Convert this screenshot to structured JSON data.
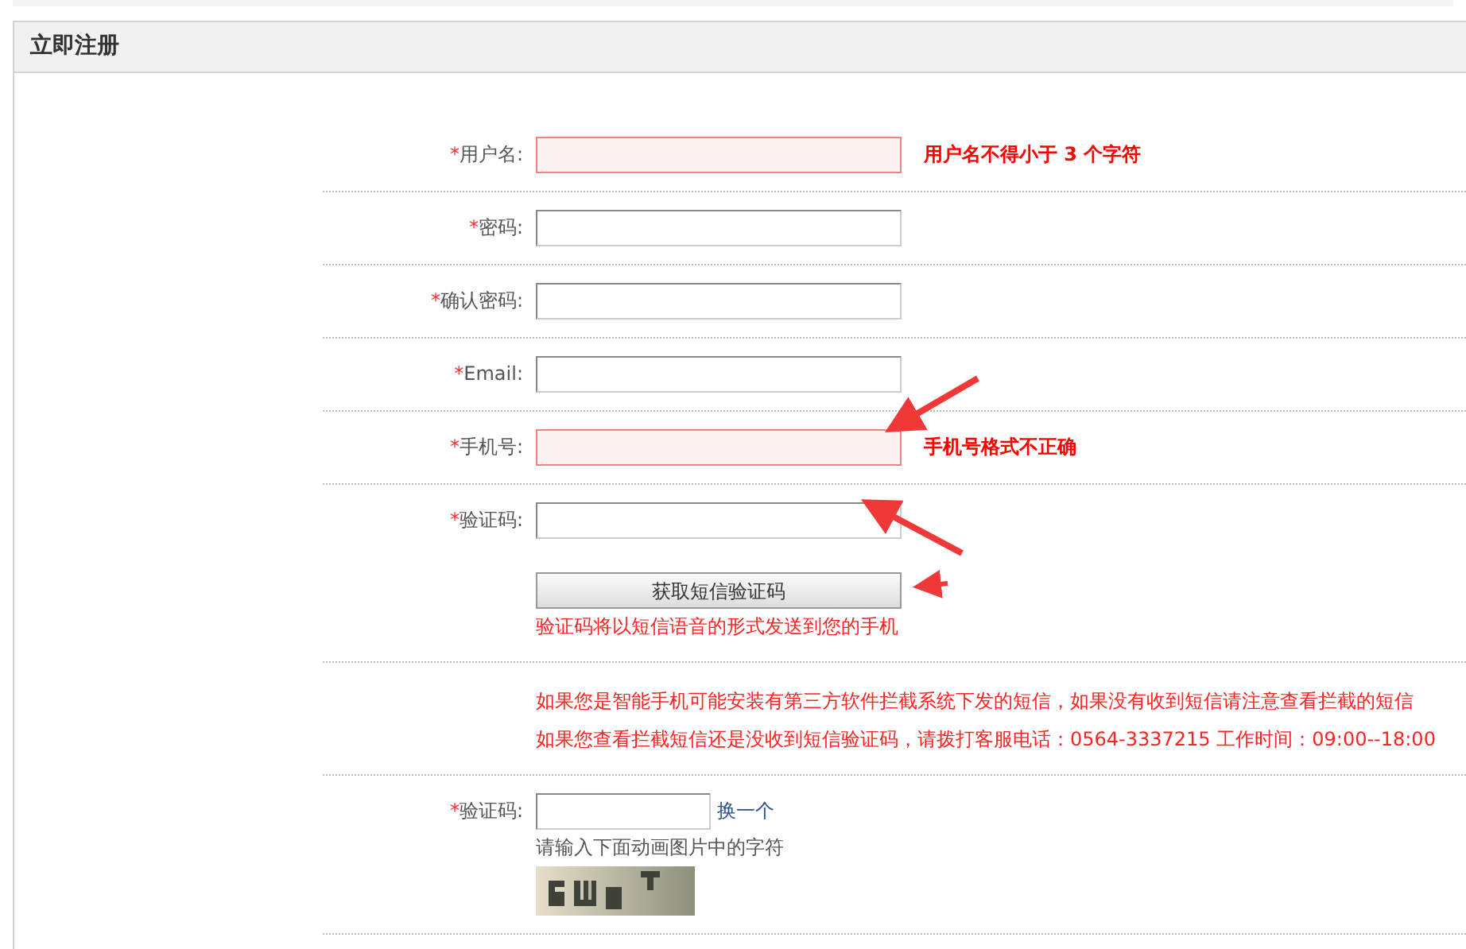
{
  "panel": {
    "title": "立即注册"
  },
  "rows": [
    {
      "kind": "field",
      "required_mark": "*",
      "label": "用户名:",
      "error": true,
      "message": "用户名不得小于 3 个字符"
    },
    {
      "kind": "field",
      "required_mark": "*",
      "label": "密码:",
      "error": false
    },
    {
      "kind": "field",
      "required_mark": "*",
      "label": "确认密码:",
      "error": false
    },
    {
      "kind": "field",
      "required_mark": "*",
      "label": "Email:",
      "error": false
    },
    {
      "kind": "field",
      "required_mark": "*",
      "label": "手机号:",
      "error": true,
      "message": "手机号格式不正确"
    },
    {
      "kind": "sms",
      "required_mark": "*",
      "label": "验证码:",
      "error": false,
      "button": "获取短信验证码",
      "note": "验证码将以短信语音的形式发送到您的手机"
    },
    {
      "kind": "notice",
      "lines": [
        "如果您是智能手机可能安装有第三方软件拦截系统下发的短信，如果没有收到短信请注意查看拦截的短信",
        "如果您查看拦截短信还是没收到短信验证码，请拨打客服电话：0564-3337215 工作时间：09:00--18:00"
      ]
    },
    {
      "kind": "captcha",
      "required_mark": "*",
      "label": "验证码:",
      "error": false,
      "link": "换一个",
      "hint": "请输入下面动画图片中的字符"
    }
  ]
}
